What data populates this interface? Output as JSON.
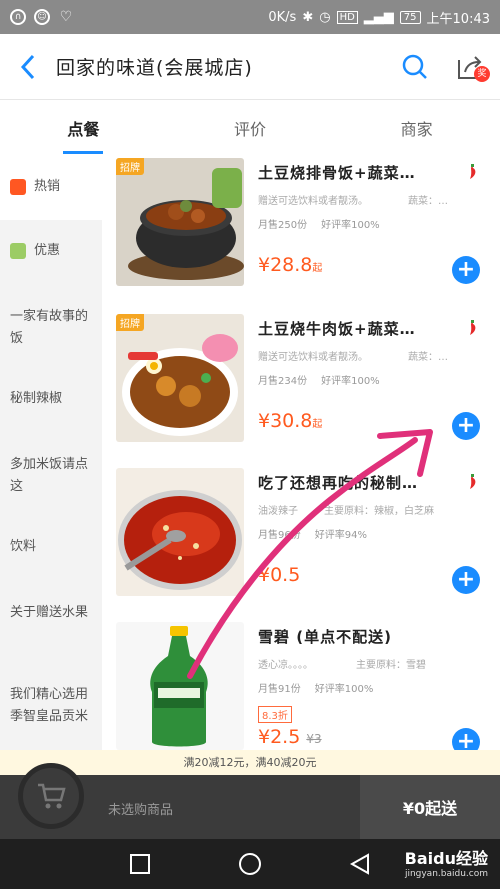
{
  "status_bar": {
    "speed": "0K/s",
    "battery": "75",
    "time": "上午10:43"
  },
  "header": {
    "title": "回家的味道(会展城店)",
    "share_badge": "奖"
  },
  "tabs": [
    "点餐",
    "评价",
    "商家"
  ],
  "sidebar": {
    "items": [
      "热销",
      "优惠",
      "一家有故事的饭",
      "秘制辣椒",
      "多加米饭请点这",
      "饮料",
      "关于赠送水果",
      "我们精心选用季智皇品贡米"
    ]
  },
  "foods": [
    {
      "name": "土豆烧排骨饭+蔬菜…",
      "tag": "招牌",
      "desc": "赠送可选饮料或者靓汤。",
      "ingredients": "蔬菜：…",
      "monthly_sales": "月售250份",
      "rating": "好评率100%",
      "price": "¥28.8",
      "price_unit": "起"
    },
    {
      "name": "土豆烧牛肉饭+蔬菜…",
      "tag": "招牌",
      "desc": "赠送可选饮料或者靓汤。",
      "ingredients": "蔬菜：…",
      "monthly_sales": "月售234份",
      "rating": "好评率100%",
      "price": "¥30.8",
      "price_unit": "起"
    },
    {
      "name": "吃了还想再吃的秘制…",
      "desc": "油泼辣子",
      "ingredients": "主要原料：辣椒，白芝麻",
      "monthly_sales": "月售96份",
      "rating": "好评率94%",
      "price": "¥0.5"
    },
    {
      "name": "雪碧 (单点不配送)",
      "desc": "透心凉。。。。",
      "ingredients": "主要原料：雪碧",
      "monthly_sales": "月售91份",
      "rating": "好评率100%",
      "discount": "8.3折",
      "price": "¥2.5",
      "old_price": "¥3"
    }
  ],
  "promo": "满20减12元，满40减20元",
  "cart": {
    "empty_text": "未选购商品",
    "min_order": "¥0起送"
  },
  "watermark": {
    "text": "Baidu经验",
    "url": "jingyan.baidu.com"
  },
  "colors": {
    "accent": "#1a8cff",
    "price": "#ff5a1f",
    "annotation_arrow": "#e0307a"
  }
}
